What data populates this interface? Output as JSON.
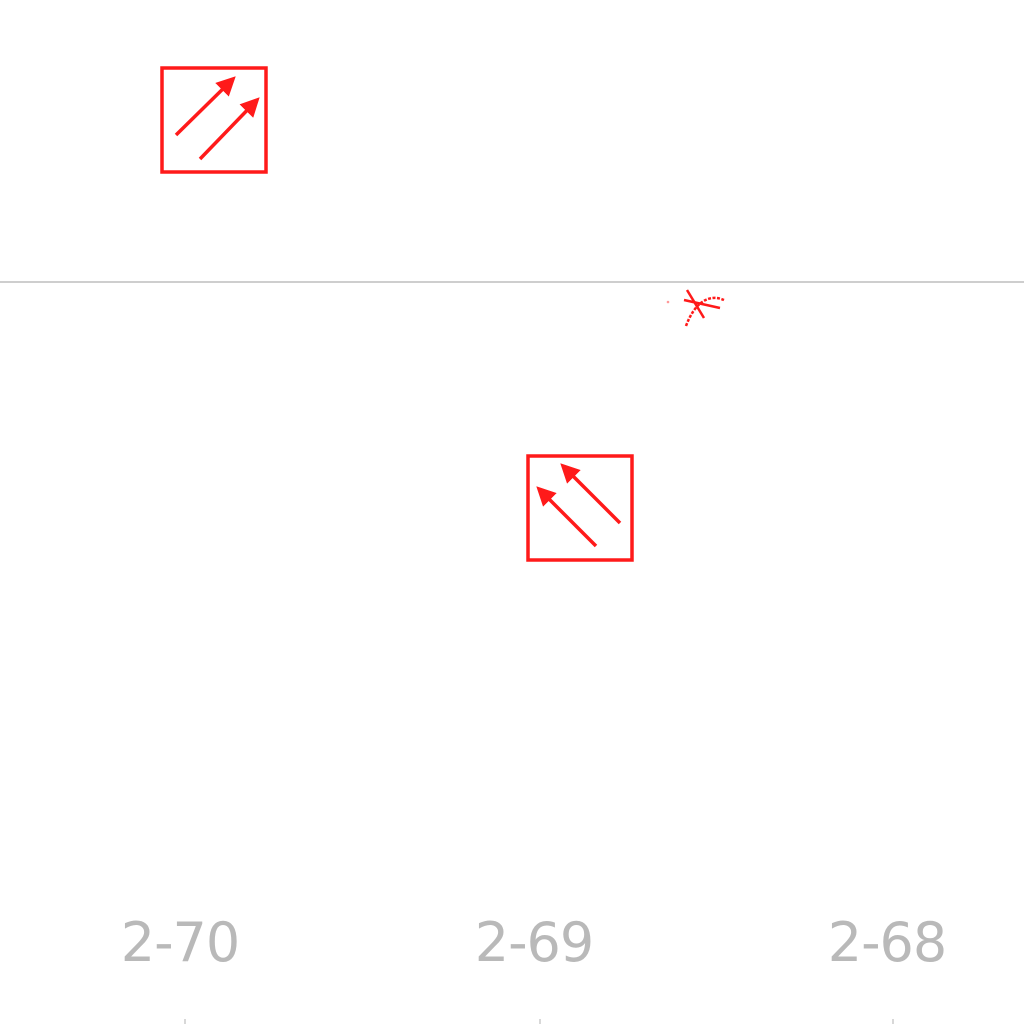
{
  "map": {
    "background": "#ffffff",
    "symbol_color": "#ff1a1a",
    "line_color": "#b0b0b0",
    "label_color": "#b9b9b9",
    "grid_labels": [
      {
        "text": "2-70"
      },
      {
        "text": "2-69"
      },
      {
        "text": "2-68"
      }
    ],
    "symbols": [
      {
        "name": "arrows-northeast-box-icon",
        "direction": "northeast"
      },
      {
        "name": "arrows-northwest-box-icon",
        "direction": "northwest"
      },
      {
        "name": "crossed-arc-icon"
      }
    ]
  }
}
